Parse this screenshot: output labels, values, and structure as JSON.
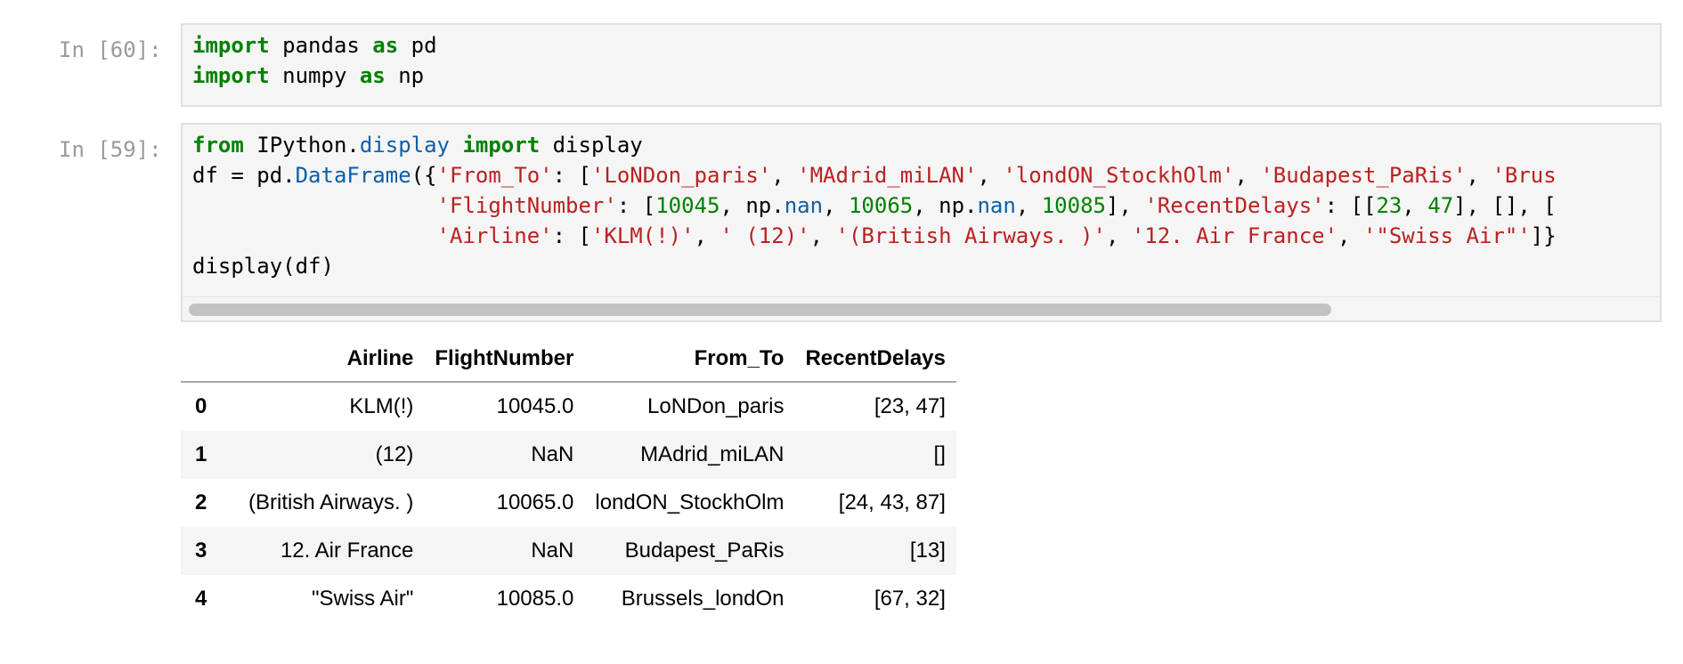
{
  "cell1": {
    "prompt": "In [60]:",
    "lines": [
      [
        {
          "t": "kw",
          "v": "import"
        },
        {
          "t": "",
          "v": " pandas "
        },
        {
          "t": "kw",
          "v": "as"
        },
        {
          "t": "",
          "v": " pd"
        }
      ],
      [
        {
          "t": "kw",
          "v": "import"
        },
        {
          "t": "",
          "v": " numpy "
        },
        {
          "t": "kw",
          "v": "as"
        },
        {
          "t": "",
          "v": " np"
        }
      ]
    ]
  },
  "cell2": {
    "prompt": "In [59]:",
    "lines": [
      [
        {
          "t": "kw",
          "v": "from"
        },
        {
          "t": "",
          "v": " IPython."
        },
        {
          "t": "attr",
          "v": "display"
        },
        {
          "t": "",
          "v": " "
        },
        {
          "t": "kw",
          "v": "import"
        },
        {
          "t": "",
          "v": " display"
        }
      ],
      [
        {
          "t": "",
          "v": "df = pd."
        },
        {
          "t": "attr",
          "v": "DataFrame"
        },
        {
          "t": "",
          "v": "({"
        },
        {
          "t": "str",
          "v": "'From_To'"
        },
        {
          "t": "",
          "v": ": ["
        },
        {
          "t": "str",
          "v": "'LoNDon_paris'"
        },
        {
          "t": "",
          "v": ", "
        },
        {
          "t": "str",
          "v": "'MAdrid_miLAN'"
        },
        {
          "t": "",
          "v": ", "
        },
        {
          "t": "str",
          "v": "'londON_StockhOlm'"
        },
        {
          "t": "",
          "v": ", "
        },
        {
          "t": "str",
          "v": "'Budapest_PaRis'"
        },
        {
          "t": "",
          "v": ", "
        },
        {
          "t": "str",
          "v": "'Brus"
        }
      ],
      [
        {
          "t": "",
          "v": "                   "
        },
        {
          "t": "str",
          "v": "'FlightNumber'"
        },
        {
          "t": "",
          "v": ": ["
        },
        {
          "t": "num",
          "v": "10045"
        },
        {
          "t": "",
          "v": ", np."
        },
        {
          "t": "attr",
          "v": "nan"
        },
        {
          "t": "",
          "v": ", "
        },
        {
          "t": "num",
          "v": "10065"
        },
        {
          "t": "",
          "v": ", np."
        },
        {
          "t": "attr",
          "v": "nan"
        },
        {
          "t": "",
          "v": ", "
        },
        {
          "t": "num",
          "v": "10085"
        },
        {
          "t": "",
          "v": "], "
        },
        {
          "t": "str",
          "v": "'RecentDelays'"
        },
        {
          "t": "",
          "v": ": [["
        },
        {
          "t": "num",
          "v": "23"
        },
        {
          "t": "",
          "v": ", "
        },
        {
          "t": "num",
          "v": "47"
        },
        {
          "t": "",
          "v": "], [], ["
        }
      ],
      [
        {
          "t": "",
          "v": "                   "
        },
        {
          "t": "str",
          "v": "'Airline'"
        },
        {
          "t": "",
          "v": ": ["
        },
        {
          "t": "str",
          "v": "'KLM(!)'"
        },
        {
          "t": "",
          "v": ", "
        },
        {
          "t": "str",
          "v": "' (12)'"
        },
        {
          "t": "",
          "v": ", "
        },
        {
          "t": "str",
          "v": "'(British Airways. )'"
        },
        {
          "t": "",
          "v": ", "
        },
        {
          "t": "str",
          "v": "'12. Air France'"
        },
        {
          "t": "",
          "v": ", "
        },
        {
          "t": "str",
          "v": "'\"Swiss Air\"'"
        },
        {
          "t": "",
          "v": "]}"
        }
      ],
      [
        {
          "t": "",
          "v": "display(df)"
        }
      ]
    ]
  },
  "table": {
    "columns": [
      "",
      "Airline",
      "FlightNumber",
      "From_To",
      "RecentDelays"
    ],
    "rows": [
      {
        "index": "0",
        "cells": [
          "KLM(!)",
          "10045.0",
          "LoNDon_paris",
          "[23, 47]"
        ]
      },
      {
        "index": "1",
        "cells": [
          "(12)",
          "NaN",
          "MAdrid_miLAN",
          "[]"
        ]
      },
      {
        "index": "2",
        "cells": [
          "(British Airways. )",
          "10065.0",
          "londON_StockhOlm",
          "[24, 43, 87]"
        ]
      },
      {
        "index": "3",
        "cells": [
          "12. Air France",
          "NaN",
          "Budapest_PaRis",
          "[13]"
        ]
      },
      {
        "index": "4",
        "cells": [
          "\"Swiss Air\"",
          "10085.0",
          "Brussels_londOn",
          "[67, 32]"
        ]
      }
    ]
  }
}
